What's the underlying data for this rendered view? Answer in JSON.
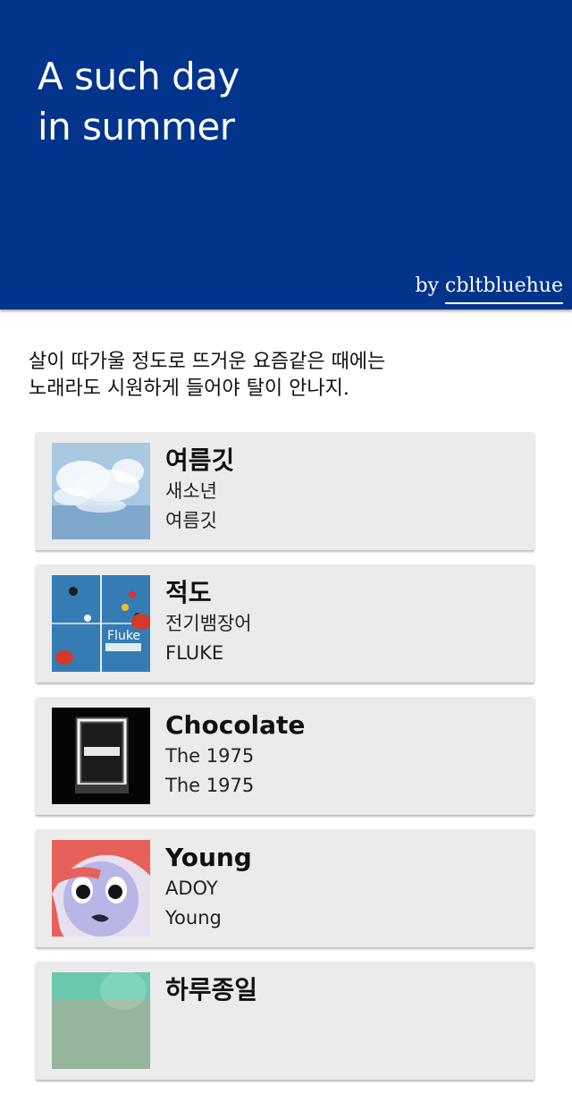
{
  "header": {
    "title_line1": "A such day",
    "title_line2": "in summer",
    "byline_prefix": "by ",
    "author": "cbltbluehue",
    "background": "#02348c"
  },
  "intro": {
    "line1": "살이 따가울 정도로 뜨거운 요즘같은 때에는",
    "line2": "노래라도 시원하게 들어야 탈이 안나지."
  },
  "tracks": [
    {
      "title": "여름깃",
      "artist": "새소년",
      "album": "여름깃",
      "cover": "cloud-artwork"
    },
    {
      "title": "적도",
      "artist": "전기뱀장어",
      "album": "FLUKE",
      "cover": "ping-pong-table-artwork"
    },
    {
      "title": "Chocolate",
      "artist": "The 1975",
      "album": "The 1975",
      "cover": "neon-logo-artwork"
    },
    {
      "title": "Young",
      "artist": "ADOY",
      "album": "Young",
      "cover": "illustrated-face-artwork"
    },
    {
      "title": "하루종일",
      "artist": "",
      "album": "",
      "cover": "teal-artwork"
    }
  ]
}
